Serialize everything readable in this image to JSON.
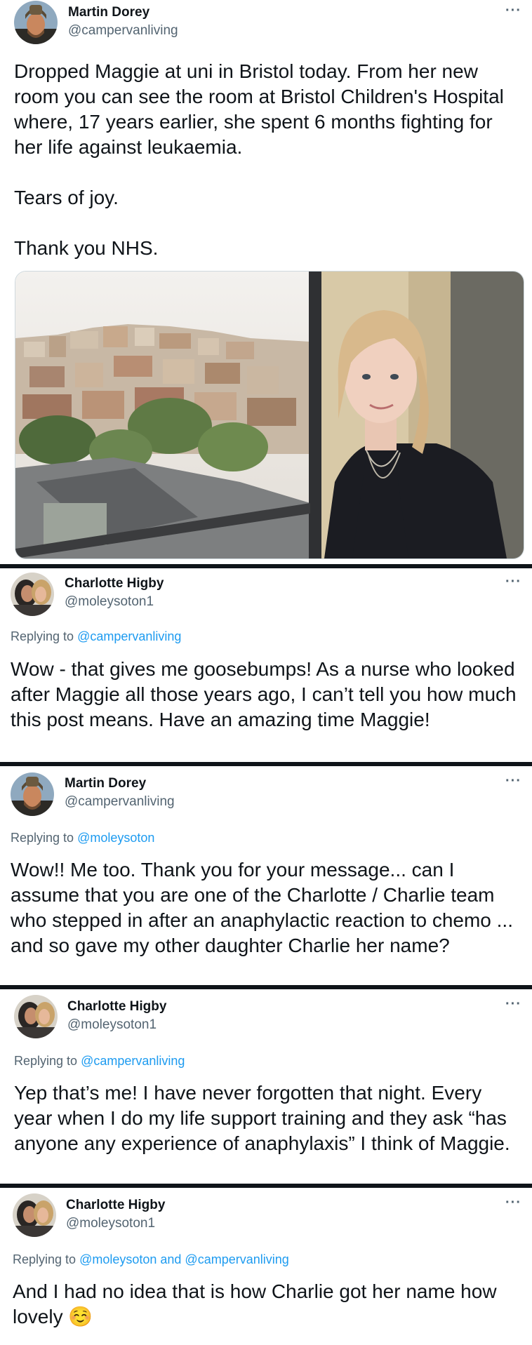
{
  "tweets": [
    {
      "name": "Martin Dorey",
      "handle": "@campervanliving",
      "more": "···",
      "text": "Dropped Maggie at uni in Bristol today. From her new room you can see the room at   Bristol Children's Hospital where, 17 years earlier, she spent 6 months fighting for her life against leukaemia.\n\nTears of joy.\n\nThank you NHS."
    },
    {
      "name": "Charlotte Higby",
      "handle": "@moleysoton1",
      "more": "···",
      "replying_prefix": "Replying to",
      "replying_to": "@campervanliving",
      "text": "Wow - that gives me goosebumps! As a nurse who looked after Maggie all those years ago, I can’t tell you how much this post means. Have an amazing time Maggie!"
    },
    {
      "name": "Martin Dorey",
      "handle": "@campervanliving",
      "more": "···",
      "replying_prefix": "Replying to",
      "replying_to": "@moleysoton",
      "text": "Wow!! Me too. Thank you for your message... can I assume that you are one of the Charlotte / Charlie team who stepped in after an anaphylactic reaction to chemo ... and so gave my other daughter Charlie her name?"
    },
    {
      "name": "Charlotte Higby",
      "handle": "@moleysoton1",
      "more": "···",
      "replying_prefix": "Replying to",
      "replying_to": "@campervanliving",
      "text": "Yep that’s me! I have never forgotten that night. Every year when I do my life support training and they ask “has anyone any experience of anaphylaxis” I think of Maggie."
    },
    {
      "name": "Charlotte Higby",
      "handle": "@moleysoton1",
      "more": "···",
      "replying_prefix": "Replying to",
      "replying_to": "@moleysoton and @campervanliving",
      "text": "And I had no idea that is how Charlie got her name how lovely ☺️"
    }
  ],
  "colors": {
    "text": "#0f1419",
    "secondary": "#536471",
    "link": "#1d9bf0",
    "divider": "#0f1419"
  },
  "icons": {
    "more": "more-options-icon",
    "emoji": "smiling-face-with-blush-emoji"
  }
}
